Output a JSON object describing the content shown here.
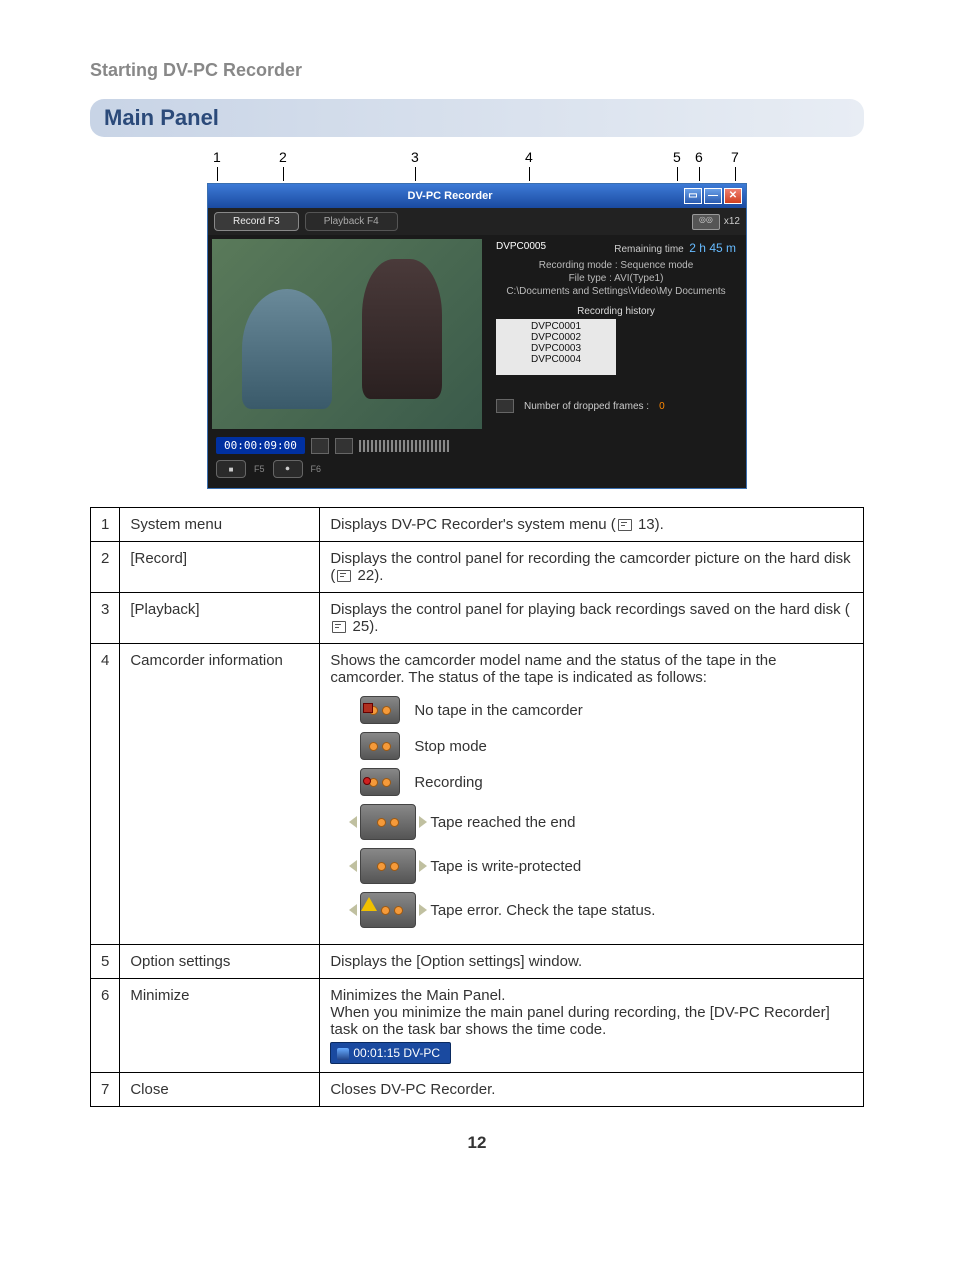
{
  "header": {
    "title": "Starting DV-PC Recorder"
  },
  "section": {
    "title": "Main Panel"
  },
  "callouts": {
    "n1": "1",
    "n2": "2",
    "n3": "3",
    "n4": "4",
    "n5": "5",
    "n6": "6",
    "n7": "7"
  },
  "window": {
    "title": "DV-PC Recorder",
    "tab_record": "Record F3",
    "tab_playback": "Playback F4",
    "tape_label": "x12",
    "current_file": "DVPC0005",
    "remaining_label": "Remaining time",
    "remaining_value": "2 h 45 m",
    "meta1": "Recording mode : Sequence mode",
    "meta2": "File type : AVI(Type1)",
    "meta3": "C:\\Documents and Settings\\Video\\My Documents",
    "history_label": "Recording history",
    "history": [
      "DVPC0001",
      "DVPC0002",
      "DVPC0003",
      "DVPC0004"
    ],
    "dropped_label": "Number of dropped frames :",
    "dropped_value": "0",
    "timecode": "00:00:09:00",
    "f5": "F5",
    "f6": "F6"
  },
  "rows": {
    "r1": {
      "num": "1",
      "name": "System menu",
      "desc_a": "Displays DV-PC Recorder's system menu (",
      "desc_b": " 13)."
    },
    "r2": {
      "num": "2",
      "name": "[Record]",
      "desc_a": "Displays the control panel for recording the camcorder picture on the hard disk (",
      "desc_b": " 22)."
    },
    "r3": {
      "num": "3",
      "name": "[Playback]",
      "desc_a": "Displays the control panel for playing back recordings saved on the hard disk (",
      "desc_b": " 25)."
    },
    "r4": {
      "num": "4",
      "name": "Camcorder information",
      "intro": "Shows the camcorder model name and the status of the tape in the camcorder. The status of the tape is indicated as follows:",
      "s1": "No tape in the camcorder",
      "s2": "Stop mode",
      "s3": "Recording",
      "s4": "Tape reached the end",
      "s5": "Tape is write-protected",
      "s6": "Tape error. Check the tape status."
    },
    "r5": {
      "num": "5",
      "name": "Option settings",
      "desc": "Displays the [Option settings] window."
    },
    "r6": {
      "num": "6",
      "name": "Minimize",
      "desc": "Minimizes the Main Panel.\nWhen you minimize the main panel during recording, the [DV-PC Recorder] task on the task bar shows the time code.",
      "chip": "00:01:15 DV-PC"
    },
    "r7": {
      "num": "7",
      "name": "Close",
      "desc": "Closes DV-PC Recorder."
    }
  },
  "page_number": "12"
}
